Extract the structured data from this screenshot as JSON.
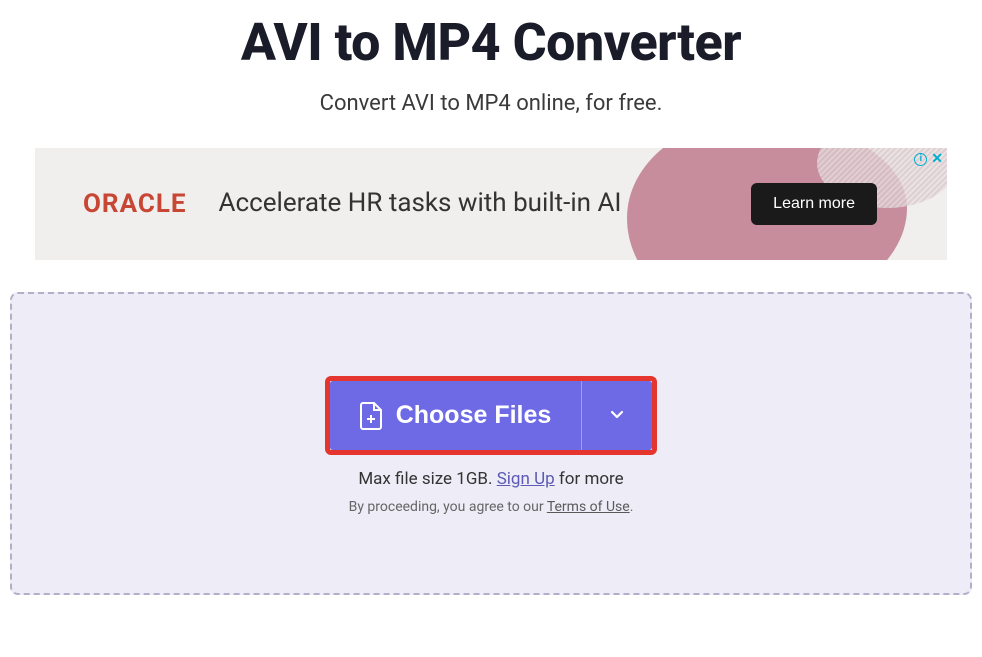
{
  "header": {
    "title": "AVI to MP4 Converter",
    "subtitle": "Convert AVI to MP4 online, for free."
  },
  "ad": {
    "brand": "ORACLE",
    "copy": "Accelerate HR tasks with built-in AI",
    "cta": "Learn more"
  },
  "dropzone": {
    "choose_label": "Choose Files",
    "size_prefix": "Max file size 1GB. ",
    "signup_label": "Sign Up",
    "size_suffix": " for more",
    "terms_prefix": "By proceeding, you agree to our ",
    "terms_link": "Terms of Use",
    "terms_suffix": "."
  }
}
